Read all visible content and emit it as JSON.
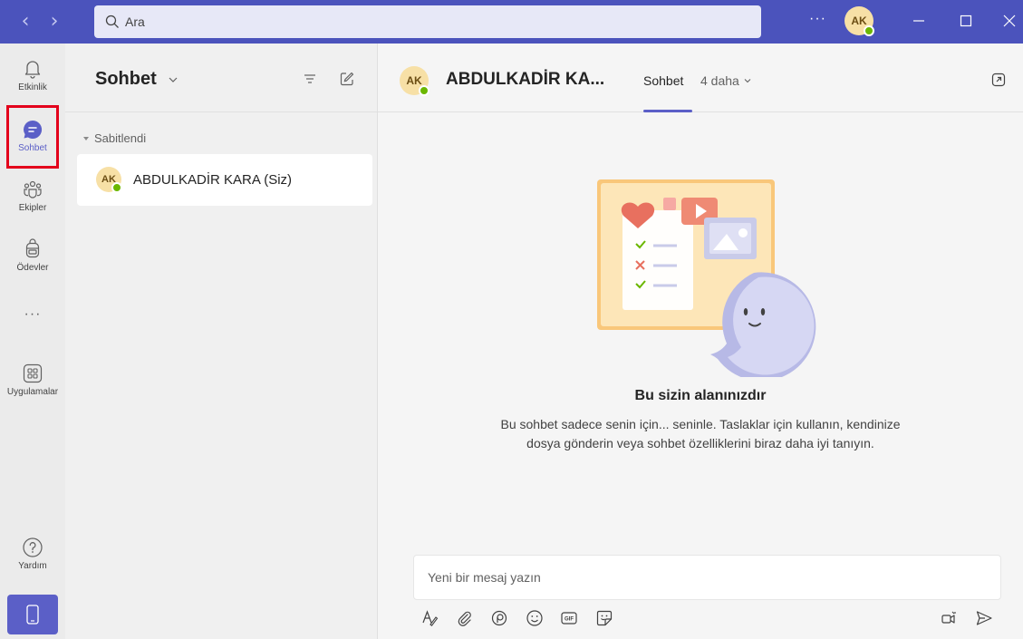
{
  "titlebar": {
    "search_placeholder": "Ara",
    "more_glyph": "···",
    "user_initials": "AK"
  },
  "rail": {
    "items": [
      {
        "label": "Etkinlik",
        "icon": "bell-icon"
      },
      {
        "label": "Sohbet",
        "icon": "chat-icon"
      },
      {
        "label": "Ekipler",
        "icon": "teams-icon"
      },
      {
        "label": "Ödevler",
        "icon": "backpack-icon"
      },
      {
        "label": "Uygulamalar",
        "icon": "apps-icon"
      },
      {
        "label": "Yardım",
        "icon": "help-icon"
      }
    ],
    "more_glyph": "···"
  },
  "chatlist": {
    "title": "Sohbet",
    "section": "Sabitlendi",
    "items": [
      {
        "initials": "AK",
        "name": "ABDULKADİR KARA (Siz)"
      }
    ]
  },
  "main": {
    "initials": "AK",
    "contact_name": "ABDULKADİR KA...",
    "tab_active": "Sohbet",
    "tab_more": "4 daha",
    "empty_title": "Bu sizin alanınızdır",
    "empty_body": "Bu sohbet sadece senin için... seninle. Taslaklar için kullanın, kendinize dosya gönderin veya sohbet özelliklerini biraz daha iyi tanıyın.",
    "composer_placeholder": "Yeni bir mesaj yazın",
    "gif_label": "GIF"
  },
  "colors": {
    "titlebar": "#4b53bc",
    "accent": "#5b5fc7",
    "presence": "#6bb700",
    "highlight": "#e3001b"
  }
}
